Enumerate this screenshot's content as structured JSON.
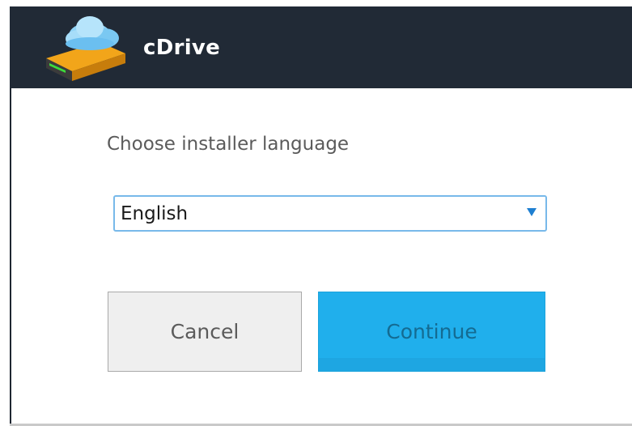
{
  "window": {
    "title": "cDrive",
    "icon": "cdrive-cloud-drive-icon"
  },
  "language_step": {
    "prompt": "Choose installer language",
    "selected_language": "English",
    "dropdown_icon": "triangle-down-icon"
  },
  "buttons": {
    "cancel_label": "Cancel",
    "continue_label": "Continue"
  },
  "colors": {
    "title_bar": "#212a36",
    "accent": "#20afec",
    "select_border": "#78b9ea",
    "cancel_bg": "#efefef"
  }
}
